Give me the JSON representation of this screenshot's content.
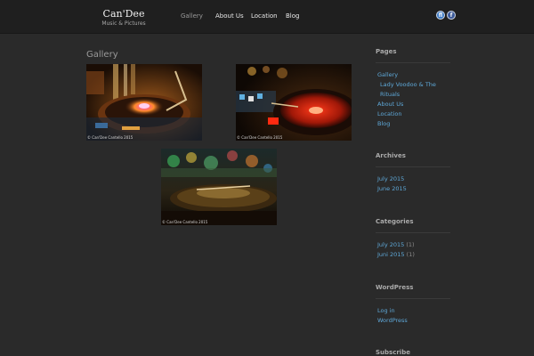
{
  "header": {
    "site_title": "Can'Dee",
    "tagline": "Music & Pictures",
    "nav": [
      {
        "label": "Gallery",
        "active": true
      },
      {
        "label": "About Us",
        "active": false
      },
      {
        "label": "Location",
        "active": false
      },
      {
        "label": "Blog",
        "active": false
      }
    ],
    "social": [
      {
        "icon": "flickr-icon",
        "glyph": "fl"
      },
      {
        "icon": "facebook-icon",
        "glyph": "f"
      }
    ]
  },
  "main": {
    "title": "Gallery",
    "images": [
      {
        "caption": "© Can'Dee Cantello 2015",
        "scene": "turntable-warm"
      },
      {
        "caption": "© Can'Dee Cantello 2015",
        "scene": "turntable-red"
      },
      {
        "caption": "© Can'Dee Cantello 2015",
        "scene": "turntable-bokeh"
      }
    ]
  },
  "sidebar": {
    "pages": {
      "title": "Pages",
      "items": [
        "Gallery",
        "Lady Voodoo & The",
        "Rituals",
        "About Us",
        "Location",
        "Blog"
      ]
    },
    "archives": {
      "title": "Archives",
      "items": [
        "July 2015",
        "June 2015"
      ]
    },
    "categories": {
      "title": "Categories",
      "items": [
        {
          "label": "July 2015",
          "count": "(1)"
        },
        {
          "label": "Juni 2015",
          "count": "(1)"
        }
      ]
    },
    "wordpress": {
      "title": "WordPress",
      "items": [
        "Log in",
        "WordPress"
      ]
    },
    "subscribe": {
      "title": "Subscribe"
    }
  },
  "colors": {
    "background": "#2a2a2a",
    "header": "#1f1f1f",
    "link": "#5ea8d8"
  }
}
